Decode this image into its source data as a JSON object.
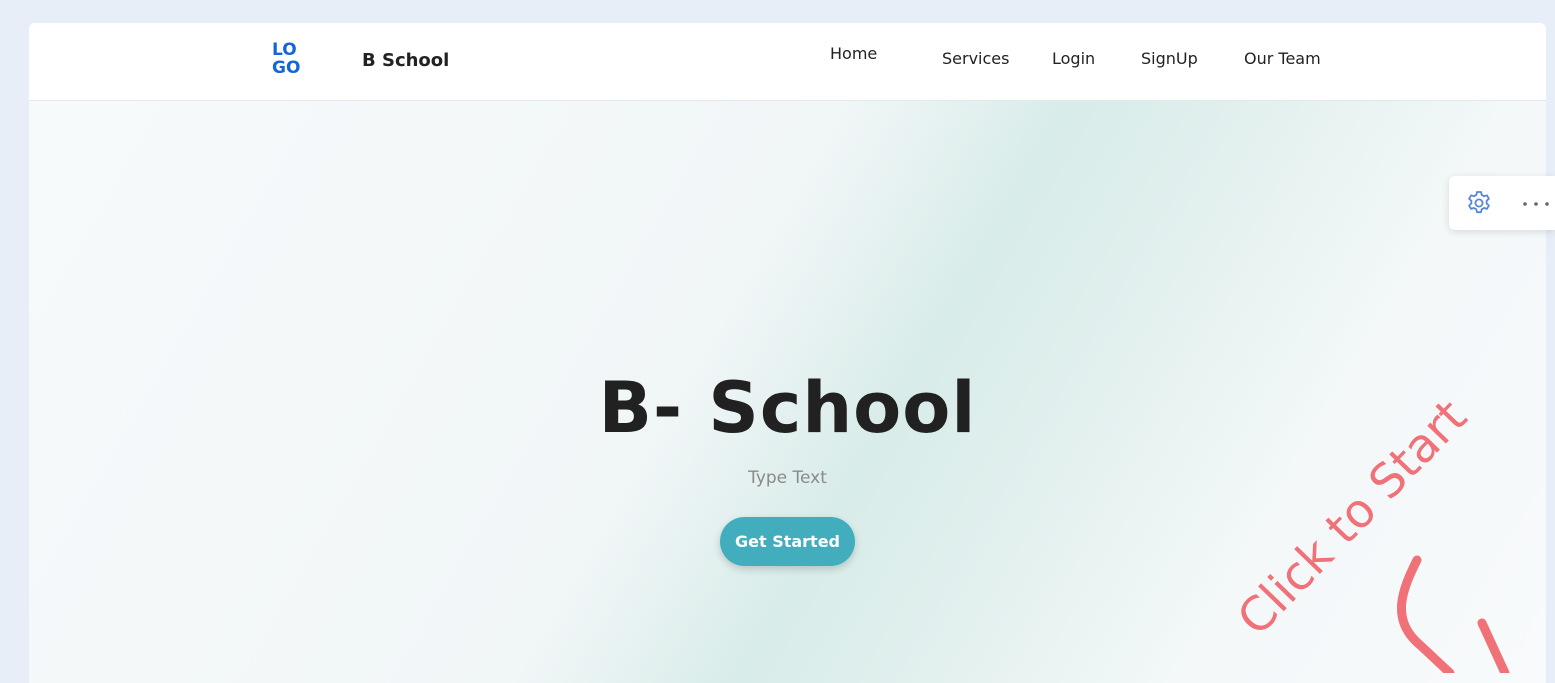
{
  "header": {
    "logo_top": "LO",
    "logo_bottom": "GO",
    "brand": "B School",
    "nav": [
      {
        "label": "Home"
      },
      {
        "label": "Services"
      },
      {
        "label": "Login"
      },
      {
        "label": "SignUp"
      },
      {
        "label": "Our Team"
      }
    ]
  },
  "hero": {
    "title": "B- School",
    "subtitle": "Type Text",
    "cta_label": "Get Started"
  },
  "overlay": {
    "text": "Click to Start",
    "color": "#f07178"
  },
  "toolbar": {
    "settings_icon": "gear-icon",
    "more_icon": "more-horizontal-icon"
  },
  "colors": {
    "accent": "#42aebd",
    "logo": "#1565d8"
  }
}
